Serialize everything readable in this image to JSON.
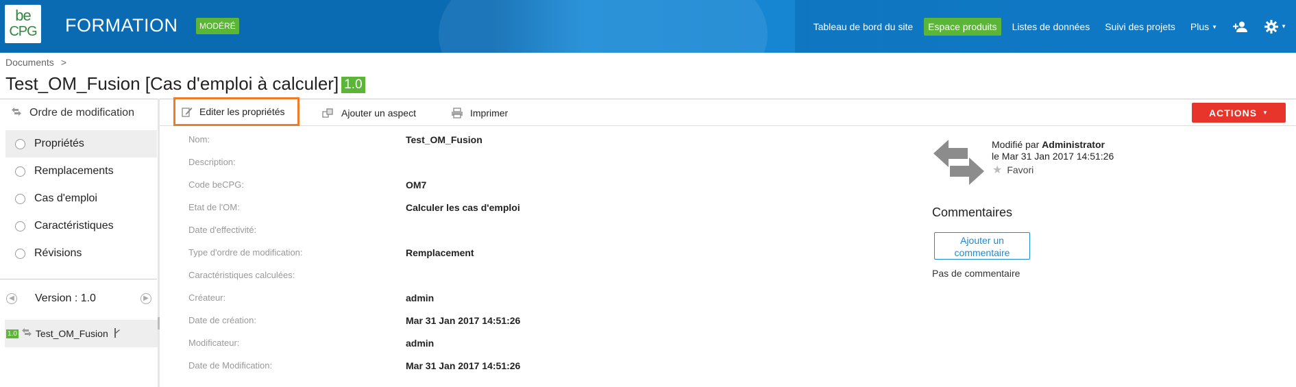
{
  "header": {
    "logo": {
      "line1": "be",
      "line2": "CPG"
    },
    "site_title": "FORMATION",
    "badge": "MODÉRÉ",
    "nav": {
      "dashboard": "Tableau de bord du site",
      "products": "Espace produits",
      "lists": "Listes de données",
      "projects": "Suivi des projets",
      "more": "Plus"
    }
  },
  "breadcrumb": {
    "documents": "Documents",
    "sep": ">"
  },
  "page": {
    "title": "Test_OM_Fusion [Cas d'emploi à calculer]",
    "version_badge": "1.0"
  },
  "sidebar": {
    "header": "Ordre de modification",
    "items": [
      {
        "label": "Propriétés"
      },
      {
        "label": "Remplacements"
      },
      {
        "label": "Cas d'emploi"
      },
      {
        "label": "Caractéristiques"
      },
      {
        "label": "Révisions"
      }
    ],
    "version_label": "Version : 1.0",
    "tree_item": {
      "badge": "1.0",
      "label": "Test_OM_Fusion"
    }
  },
  "toolbar": {
    "edit": "Editer les propriétés",
    "aspect": "Ajouter un aspect",
    "print": "Imprimer",
    "actions": "ACTIONS"
  },
  "properties": [
    {
      "key": "Nom:",
      "value": "Test_OM_Fusion"
    },
    {
      "key": "Description:",
      "value": ""
    },
    {
      "key": "Code beCPG:",
      "value": "OM7"
    },
    {
      "key": "Etat de l'OM:",
      "value": "Calculer les cas d'emploi"
    },
    {
      "key": "Date d'effectivité:",
      "value": ""
    },
    {
      "key": "Type d'ordre de modification:",
      "value": "Remplacement"
    },
    {
      "key": "Caractéristiques calculées:",
      "value": ""
    },
    {
      "key": "Créateur:",
      "value": "admin"
    },
    {
      "key": "Date de création:",
      "value": "Mar 31 Jan 2017 14:51:26"
    },
    {
      "key": "Modificateur:",
      "value": "admin"
    },
    {
      "key": "Date de Modification:",
      "value": "Mar 31 Jan 2017 14:51:26"
    }
  ],
  "right_panel": {
    "modified_by_prefix": "Modifié par",
    "modified_by": "Administrator",
    "modified_date": "le Mar 31 Jan 2017 14:51:26",
    "favorite": "Favori",
    "comments_title": "Commentaires",
    "add_comment": "Ajouter un commentaire",
    "no_comment": "Pas de commentaire"
  }
}
